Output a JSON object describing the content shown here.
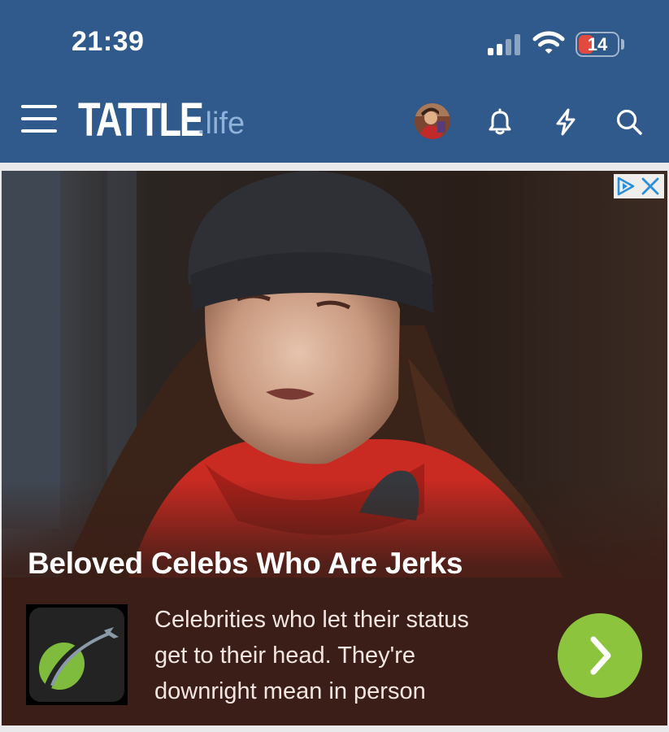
{
  "status_bar": {
    "time": "21:39",
    "battery_percent": "14",
    "battery_level": 0.14,
    "signal_bars_active": 2,
    "signal_bars_total": 4
  },
  "site_header": {
    "logo_main": "TATTLE",
    "logo_sub": ".life",
    "icons": [
      "menu-icon",
      "avatar",
      "bell-icon",
      "lightning-icon",
      "search-icon"
    ]
  },
  "advert": {
    "title": "Beloved Celebs Who Are Jerks",
    "description_lines": [
      "Celebrities who let their status",
      "get to their head. They're",
      "downright mean in person"
    ],
    "choices_icons": [
      "adchoices-icon",
      "close-icon"
    ],
    "cta_icon": "chevron-right-icon"
  },
  "colors": {
    "header_bg": "#30598c",
    "logo_sub": "#8fb2d9",
    "ad_panel": "#3a1e17",
    "cta_green": "#8cc43e",
    "battery_red": "#e34a3f",
    "adchoices_blue": "#2a8fd6"
  }
}
